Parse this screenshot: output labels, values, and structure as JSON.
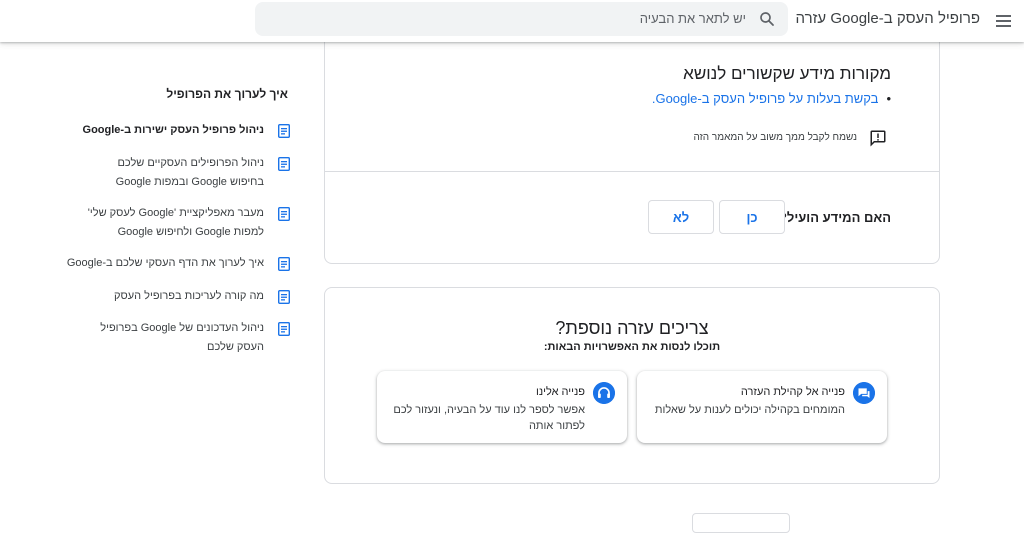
{
  "header": {
    "title": "פרופיל העסק ב-Google עזרה",
    "search_placeholder": "יש לתאר את הבעיה"
  },
  "article": {
    "related_title": "מקורות מידע שקשורים לנושא",
    "related_links": [
      "בקשת בעלות על פרופיל העסק ב-Google."
    ],
    "feedback_text": "נשמח לקבל ממך משוב על המאמר הזה",
    "helpful_question": "האם המידע הועיל?",
    "yes_label": "כן",
    "no_label": "לא"
  },
  "help": {
    "title": "צריכים עזרה נוספת?",
    "subtitle": "תוכלו לנסות את האפשרויות הבאות:",
    "options": [
      {
        "title": "פנייה אל קהילת העזרה",
        "desc": "המומחים בקהילה יכולים לענות על שאלות",
        "icon": "forum-icon"
      },
      {
        "title": "פנייה אלינו",
        "desc": "אפשר לספר לנו עוד על הבעיה, ונעזור לכם לפתור אותה",
        "icon": "headset-icon"
      }
    ]
  },
  "sidebar": {
    "title": "איך לערוך את הפרופיל",
    "items": [
      {
        "label": "ניהול פרופיל העסק ישירות ב-Google",
        "bold": true
      },
      {
        "label": "ניהול הפרופילים העסקיים שלכם בחיפוש Google ובמפות Google"
      },
      {
        "label": "מעבר מאפליקציית 'Google לעסק שלי' למפות Google ולחיפוש Google"
      },
      {
        "label": "איך לערוך את הדף העסקי שלכם ב-Google"
      },
      {
        "label": "מה קורה לעריכות בפרופיל העסק"
      },
      {
        "label": "ניהול העדכונים של Google בפרופיל העסק שלכם"
      }
    ]
  },
  "colors": {
    "accent": "#1a73e8",
    "border": "#dadce0"
  }
}
